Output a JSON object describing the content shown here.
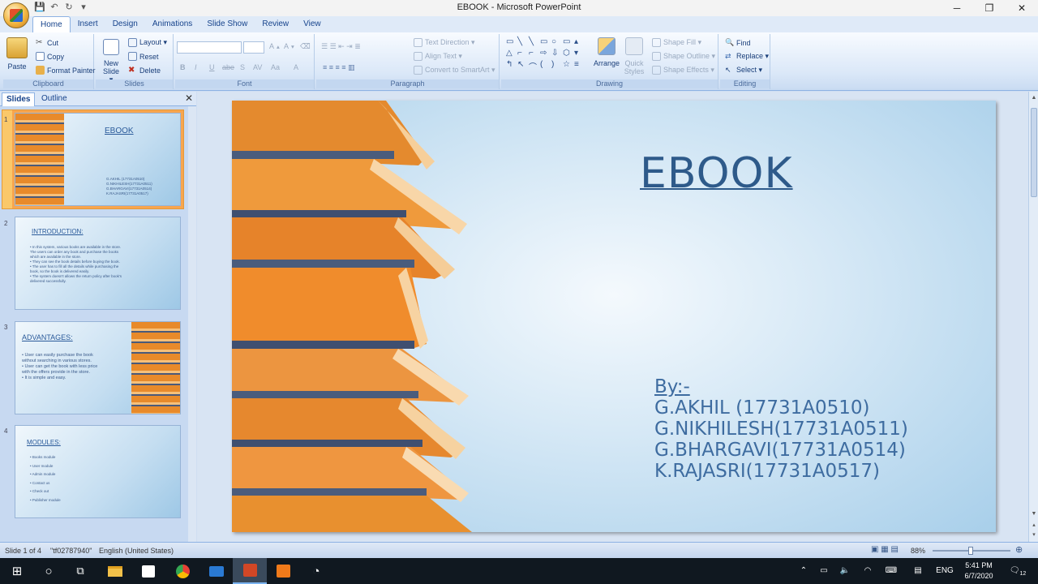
{
  "window": {
    "title": "EBOOK - Microsoft PowerPoint",
    "controls": [
      "─",
      "❐",
      "✕"
    ]
  },
  "tabs": [
    "Home",
    "Insert",
    "Design",
    "Animations",
    "Slide Show",
    "Review",
    "View"
  ],
  "ribbon": {
    "clipboard": {
      "label": "Clipboard",
      "paste": "Paste",
      "cut": "Cut",
      "copy": "Copy",
      "format_painter": "Format Painter"
    },
    "slides": {
      "label": "Slides",
      "new_slide": "New Slide ▾",
      "layout": "Layout ▾",
      "reset": "Reset",
      "delete": "Delete"
    },
    "font": {
      "label": "Font",
      "buttons": [
        "B",
        "I",
        "U",
        "abe",
        "S",
        "AV",
        "Aa",
        "A"
      ]
    },
    "paragraph": {
      "label": "Paragraph",
      "text_direction": "Text Direction ▾",
      "align_text": "Align Text ▾",
      "convert_smartart": "Convert to SmartArt ▾"
    },
    "drawing": {
      "label": "Drawing",
      "arrange": "Arrange",
      "quick_styles": "Quick Styles",
      "shape_fill": "Shape Fill ▾",
      "shape_outline": "Shape Outline ▾",
      "shape_effects": "Shape Effects ▾"
    },
    "editing": {
      "label": "Editing",
      "find": "Find",
      "replace": "Replace ▾",
      "select": "Select ▾"
    }
  },
  "pane": {
    "tabs": [
      "Slides",
      "Outline"
    ],
    "close": "✕",
    "thumbs": [
      {
        "num": "1",
        "title": "EBOOK",
        "body": [
          "G.AKHIL (17731A0510)",
          "G.NIKHILESH(17731A0511)",
          "G.BHARGAVI(17731A0514)",
          "K.RAJASRI(17731A0517)"
        ]
      },
      {
        "num": "2",
        "title": "INTRODUCTION:",
        "body": [
          "• In this system, various books are available in the store.",
          "  The users can order any book and purchase the books",
          "  which are available in the store.",
          "• They can see the book details before buying the book.",
          "• The user has to fill all the details while purchasing the",
          "  book, so the book is delivered easily.",
          "• The system doesn't allows the return policy after book's",
          "  delivered successfully."
        ]
      },
      {
        "num": "3",
        "title": "ADVANTAGES:",
        "body": [
          "• User can easily purchase the book",
          "  without searching in various stores.",
          "• User can get the book with less price",
          "  with the offers provide in the store.",
          "• It is simple and easy."
        ]
      },
      {
        "num": "4",
        "title": "MODULES:",
        "body": [
          "• Books module",
          "• User module",
          "• Admin module",
          "• Contact us",
          "• Check out",
          "• Publisher module"
        ]
      }
    ]
  },
  "slide": {
    "title": "EBOOK",
    "by": "By:-",
    "authors": [
      "G.AKHIL (17731A0510)",
      "G.NIKHILESH(17731A0511)",
      "G.BHARGAVI(17731A0514)",
      "K.RAJASRI(17731A0517)"
    ]
  },
  "status": {
    "slide_of": "Slide 1 of 4",
    "theme": "\"tf02787940\"",
    "language": "English (United States)",
    "zoom": "88%"
  },
  "taskbar": {
    "language": "ENG",
    "time": "5:41 PM",
    "date": "6/7/2020",
    "notification_count": "12"
  }
}
